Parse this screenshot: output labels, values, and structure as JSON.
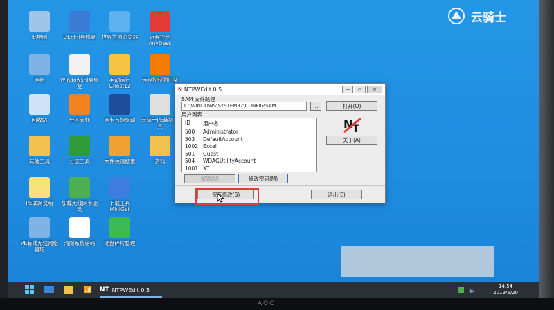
{
  "desktop_icons": [
    {
      "label": "此电脑",
      "icon": "computer-icon",
      "color": "#9fc6ea"
    },
    {
      "label": "UEFI引导修复",
      "icon": "uefi-repair-icon",
      "color": "#3a7bd5"
    },
    {
      "label": "世界之窗浏览器",
      "icon": "browser-globe-icon",
      "color": "#5fb0ef"
    },
    {
      "label": "远程控制AnyDesk",
      "icon": "anydesk-icon",
      "color": "#e53935"
    },
    {
      "label": "网络",
      "icon": "network-icon",
      "color": "#7fb3e6"
    },
    {
      "label": "Windows引导修复",
      "icon": "windows-boot-icon",
      "color": "#f2f2f2"
    },
    {
      "label": "手动运行Ghost12",
      "icon": "ghost-icon",
      "color": "#f5c542"
    },
    {
      "label": "远程控制向日葵",
      "icon": "sunflower-icon",
      "color": "#f57c00"
    },
    {
      "label": "回收站",
      "icon": "recycle-bin-icon",
      "color": "#cfe3f6"
    },
    {
      "label": "分区大师",
      "icon": "partition-master-icon",
      "color": "#f58220"
    },
    {
      "label": "网卡万能驱动",
      "icon": "network-driver-icon",
      "color": "#1e4e9a"
    },
    {
      "label": "云骑士PE装机工具",
      "icon": "installer-icon",
      "color": "#e0e0e0"
    },
    {
      "label": "其他工具",
      "icon": "folder-icon",
      "color": "#f2c24f"
    },
    {
      "label": "分区工具",
      "icon": "partition-tool-icon",
      "color": "#2e9c3a"
    },
    {
      "label": "文件快速搜索",
      "icon": "file-search-icon",
      "color": "#f0a030"
    },
    {
      "label": "资料",
      "icon": "folder-icon",
      "color": "#f2c24f"
    },
    {
      "label": "PE联网说明",
      "icon": "pdf-icon",
      "color": "#f6e27a"
    },
    {
      "label": "加载无线网卡驱动",
      "icon": "wifi-driver-icon",
      "color": "#4caf50"
    },
    {
      "label": "下载工具MiniGet",
      "icon": "download-tool-icon",
      "color": "#3d7de0"
    },
    {
      "label": "",
      "icon": "empty",
      "color": "transparent"
    },
    {
      "label": "PE有线无线网络管理",
      "icon": "network-manager-icon",
      "color": "#7fb3e6"
    },
    {
      "label": "清除系统密码",
      "icon": "ntpwedit-icon",
      "color": "#ffffff"
    },
    {
      "label": "硬盘碎片整理",
      "icon": "defrag-icon",
      "color": "#3cba54"
    }
  ],
  "window": {
    "title": "NTPWEdit 0.5",
    "sam_label": "SAM 文件路径",
    "sam_path": "C:\\WINDOWS\\SYSTEM32\\CONFIG\\SAM",
    "browse_label": "...",
    "open_label": "打开(O)",
    "user_list_label": "用户列表",
    "col_id": "ID",
    "col_name": "用户名",
    "users": [
      {
        "id": "500",
        "name": "Administrator"
      },
      {
        "id": "503",
        "name": "DefaultAccount"
      },
      {
        "id": "1002",
        "name": "Excel"
      },
      {
        "id": "501",
        "name": "Guest"
      },
      {
        "id": "504",
        "name": "WDAGUtilityAccount"
      },
      {
        "id": "1001",
        "name": "XT"
      }
    ],
    "unlock_label": "解锁(U)",
    "change_pw_label": "修改密码(M)",
    "save_label": "保存修改(S)",
    "exit_label": "退出(E)",
    "about_label": "关于(A)",
    "logo_text": "NT"
  },
  "taskbar": {
    "app_label": "NTPWEdit 0.5",
    "time": "14:54",
    "date": "2019/5/20"
  },
  "watermark": "云骑士",
  "monitor_brand": "AOC"
}
